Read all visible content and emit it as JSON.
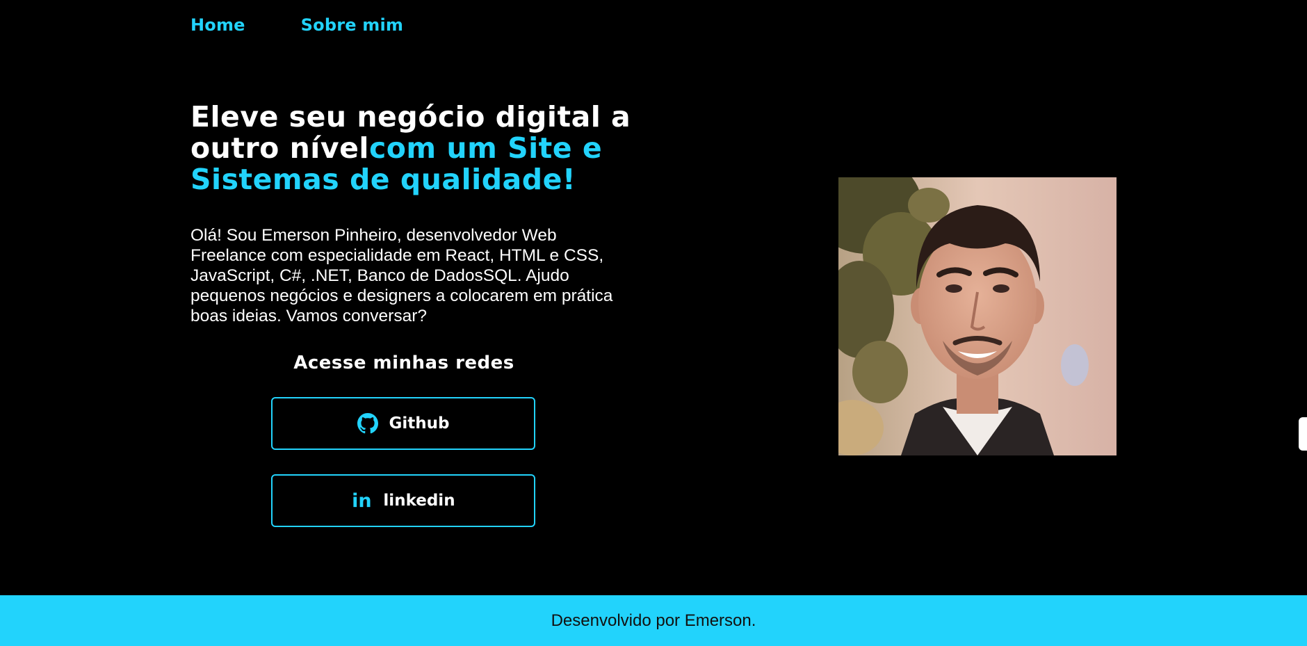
{
  "nav": {
    "items": [
      {
        "label": "Home"
      },
      {
        "label": "Sobre mim"
      }
    ]
  },
  "hero": {
    "title_white": "Eleve seu negócio digital a outro nível",
    "title_accent": "com um Site e Sistemas de qualidade!",
    "description": "Olá! Sou Emerson Pinheiro, desenvolvedor Web Freelance com especialidade em React, HTML e CSS, JavaScript, C#, .NET, Banco de DadosSQL. Ajudo pequenos negócios e designers a colocarem em prática boas ideias. Vamos conversar?"
  },
  "social": {
    "heading": "Acesse minhas redes",
    "buttons": [
      {
        "label": "Github",
        "icon": "github-icon"
      },
      {
        "label": "linkedin",
        "icon": "linkedin-icon"
      }
    ]
  },
  "footer": {
    "text": "Desenvolvido por Emerson."
  },
  "colors": {
    "accent": "#22d3fc",
    "background": "#000000",
    "text": "#ffffff"
  }
}
